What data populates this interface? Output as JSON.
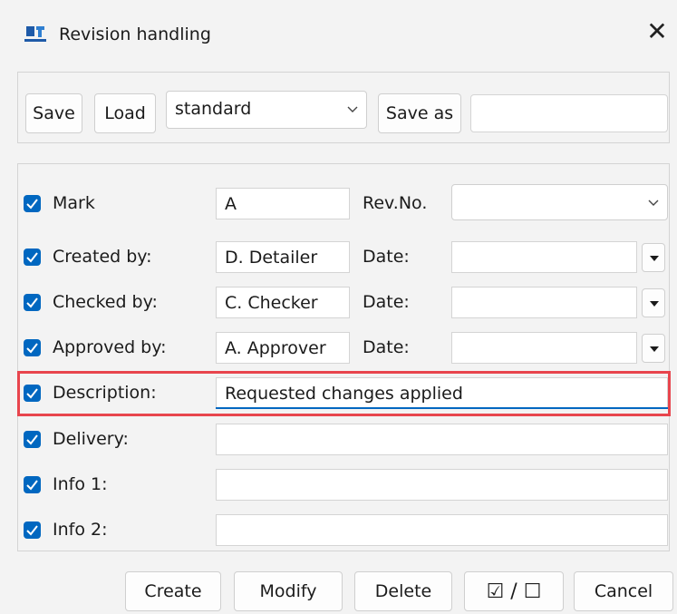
{
  "window": {
    "title": "Revision handling",
    "app_icon": "revision-app-icon",
    "close_glyph": "✕"
  },
  "toolbar": {
    "save_label": "Save",
    "load_label": "Load",
    "preset_value": "standard",
    "save_as_label": "Save as",
    "save_as_value": ""
  },
  "fields": [
    {
      "label": "Mark",
      "value": "A",
      "checked": true,
      "right_label": "Rev.No.",
      "right_value": ""
    },
    {
      "label": "Created by:",
      "value": "D. Detailer",
      "checked": true,
      "right_label": "Date:",
      "right_value": ""
    },
    {
      "label": "Checked by:",
      "value": "C. Checker",
      "checked": true,
      "right_label": "Date:",
      "right_value": ""
    },
    {
      "label": "Approved by:",
      "value": "A. Approver",
      "checked": true,
      "right_label": "Date:",
      "right_value": ""
    },
    {
      "label": "Description:",
      "value": "Requested changes applied",
      "checked": true
    },
    {
      "label": "Delivery:",
      "value": "",
      "checked": true
    },
    {
      "label": "Info 1:",
      "value": "",
      "checked": true
    },
    {
      "label": "Info 2:",
      "value": "",
      "checked": true
    }
  ],
  "buttons": {
    "create": "Create",
    "modify": "Modify",
    "delete": "Delete",
    "toggle": "☑ / ☐",
    "cancel": "Cancel"
  },
  "colors": {
    "accent": "#0067c0",
    "highlight": "#e8454d"
  }
}
